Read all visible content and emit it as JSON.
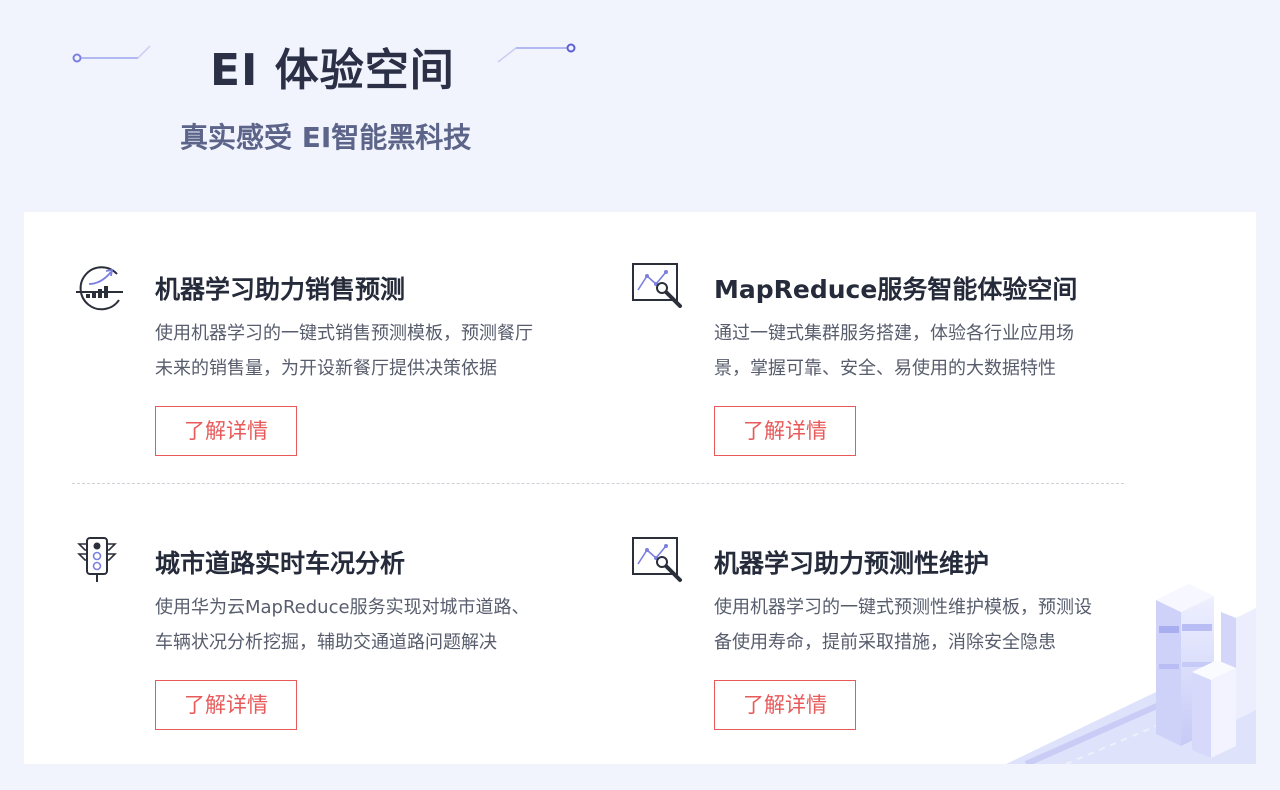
{
  "header": {
    "title": "EI 体验空间",
    "subtitle": "真实感受 EI智能黑科技"
  },
  "colors": {
    "background": "#f1f4fd",
    "accent_red": "#e85a5a",
    "deco_purple": "#7b7fe0"
  },
  "items": [
    {
      "icon": "sales-chart-icon",
      "title": "机器学习助力销售预测",
      "desc_line1": "使用机器学习的一键式销售预测模板，预测餐厅",
      "desc_line2": "未来的销售量，为开设新餐厅提供决策依据",
      "button": "了解详情"
    },
    {
      "icon": "chart-wrench-icon",
      "title": "MapReduce服务智能体验空间",
      "desc_line1": "通过一键式集群服务搭建，体验各行业应用场",
      "desc_line2": "景，掌握可靠、安全、易使用的大数据特性",
      "button": "了解详情"
    },
    {
      "icon": "traffic-light-icon",
      "title": "城市道路实时车况分析",
      "desc_line1": "使用华为云MapReduce服务实现对城市道路、",
      "desc_line2": "车辆状况分析挖掘，辅助交通道路问题解决",
      "button": "了解详情"
    },
    {
      "icon": "chart-wrench-icon",
      "title": "机器学习助力预测性维护",
      "desc_line1": "使用机器学习的一键式预测性维护模板，预测设",
      "desc_line2": "备使用寿命，提前采取措施，消除安全隐患",
      "button": "了解详情"
    }
  ]
}
